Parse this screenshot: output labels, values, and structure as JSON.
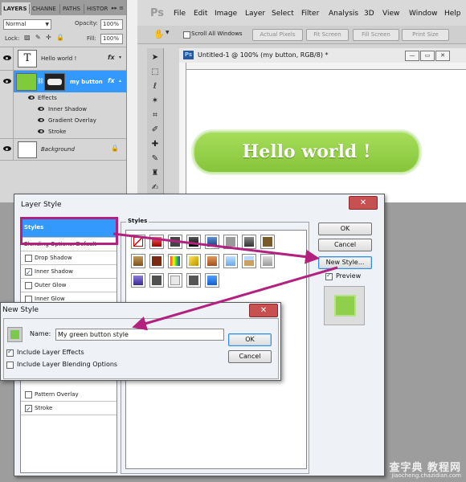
{
  "layers_panel": {
    "tabs": [
      "LAYERS",
      "CHANNE",
      "PATHS",
      "HISTOR"
    ],
    "blend_mode": "Normal",
    "opacity_label": "Opacity:",
    "opacity_value": "100%",
    "lock_label": "Lock:",
    "fill_label": "Fill:",
    "fill_value": "100%",
    "layers": [
      {
        "name": "Hello world !",
        "thumb": "T",
        "fx": "fx"
      },
      {
        "name": "my button",
        "fx": "fx"
      },
      {
        "name": "Background"
      }
    ],
    "effects_label": "Effects",
    "effects": [
      "Inner Shadow",
      "Gradient Overlay",
      "Stroke"
    ]
  },
  "app": {
    "logo": "Ps",
    "menu": [
      "File",
      "Edit",
      "Image",
      "Layer",
      "Select",
      "Filter",
      "Analysis",
      "3D",
      "View",
      "Window",
      "Help"
    ],
    "options": {
      "scroll_all": "Scroll All Windows",
      "buttons": [
        "Actual Pixels",
        "Fit Screen",
        "Fill Screen",
        "Print Size"
      ]
    },
    "document": {
      "title": "Untitled-1 @ 100% (my button, RGB/8) *",
      "button_text": "Hello world !"
    }
  },
  "layer_style_dialog": {
    "title": "Layer Style",
    "left_items": [
      {
        "label": "Styles",
        "checked": null,
        "selected": true
      },
      {
        "label": "Blending Options: Default",
        "checked": null
      },
      {
        "label": "Drop Shadow",
        "checked": false
      },
      {
        "label": "Inner Shadow",
        "checked": true
      },
      {
        "label": "Outer Glow",
        "checked": false
      },
      {
        "label": "Inner Glow",
        "checked": false
      }
    ],
    "left_items_bottom": [
      {
        "label": "Pattern Overlay",
        "checked": false
      },
      {
        "label": "Stroke",
        "checked": true
      }
    ],
    "styles_label": "Styles",
    "ok_label": "OK",
    "cancel_label": "Cancel",
    "new_style_label": "New Style...",
    "preview_label": "Preview",
    "preview_checked": true
  },
  "new_style_dialog": {
    "title": "New Style",
    "name_label": "Name:",
    "name_value": "My green button style",
    "include_effects_label": "Include Layer Effects",
    "include_effects_checked": true,
    "include_blending_label": "Include Layer Blending Options",
    "include_blending_checked": false,
    "ok_label": "OK",
    "cancel_label": "Cancel"
  },
  "watermark": {
    "main": "查字典 教程网",
    "sub": "jiaocheng.chazidian.com"
  },
  "colors": {
    "highlight": "#b3217f",
    "button_green": "#8fd04b",
    "selection_blue": "#3399ff"
  }
}
